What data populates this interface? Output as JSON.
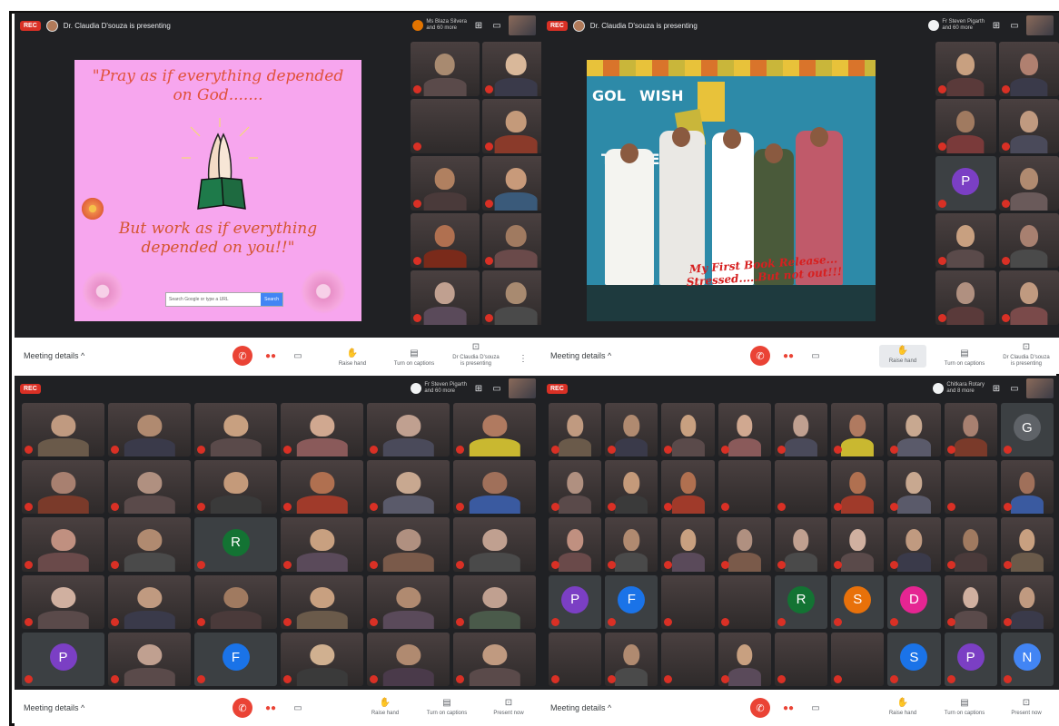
{
  "colors": {
    "meet_dark": "#202124",
    "tile_dark": "#3c4043",
    "end_call_red": "#ea4335",
    "mic_off_red": "#d93025",
    "slide1_pink": "#f7a6ee",
    "slide1_text": "#e0513a",
    "slide2_blue": "#2d8aa8",
    "caption_red": "#d62020"
  },
  "common": {
    "rec_label": "REC",
    "meeting_details_label": "Meeting details ^",
    "end_call_icon": "phone-hangup-icon",
    "raise_hand_label": "Raise hand",
    "captions_label": "Turn on captions",
    "present_now_label": "Present now"
  },
  "q1": {
    "presenting_text": "Dr. Claudia D'souza is presenting",
    "pinned_name": "Ms Blaza Silvera",
    "pinned_sub": "and 60 more",
    "presenter_action_label": "Dr Claudia D'souza is presenting",
    "slide": {
      "quote_top_line1": "\"Pray as if everything depended",
      "quote_top_line2": "on God.......",
      "quote_bottom_line1": "But work as if everything",
      "quote_bottom_line2": "depended on you!!\"",
      "search_placeholder": "Search Google or type a URL",
      "search_button": "Search"
    },
    "tiles": [
      {
        "tone": "#a88a70",
        "body": "#5a4a4a"
      },
      {
        "tone": "#d9b89a",
        "body": "#3a3a4a"
      },
      {
        "tone": "#3c4043",
        "body": "#3c4043",
        "blank": true
      },
      {
        "tone": "#c49a7a",
        "body": "#8a3a2a"
      },
      {
        "tone": "#b08060",
        "body": "#4a3a3a"
      },
      {
        "tone": "#c89a7a",
        "body": "#3a5a7a"
      },
      {
        "tone": "#b07050",
        "body": "#7a2a1a"
      },
      {
        "tone": "#a07a60",
        "body": "#6a4a4a"
      },
      {
        "tone": "#c0a090",
        "body": "#5a4a5a"
      },
      {
        "tone": "#a88a70",
        "body": "#4a4a4a"
      }
    ]
  },
  "q2": {
    "presenting_text": "Dr. Claudia D'souza is presenting",
    "pinned_name": "Fr Steven Pigarth",
    "pinned_sub": "and 60 more",
    "presenter_action_label": "Dr Claudia D'souza is presenting",
    "slide": {
      "banner_word1": "GOL",
      "banner_word2": "WISH",
      "banner_word3": "TO",
      "banner_word4": "OE",
      "caption_line1": "My First Book Release...",
      "caption_line2": "Stressed.....But not out!!!"
    },
    "tiles": [
      {
        "tone": "#c8a080",
        "body": "#5a3a3a"
      },
      {
        "tone": "#b08070",
        "body": "#3a3a4a"
      },
      {
        "tone": "#a07a60",
        "body": "#7a3a3a"
      },
      {
        "tone": "#c09a80",
        "body": "#4a4a5a"
      },
      {
        "initial": "P",
        "initial_color": "#7b3fc4"
      },
      {
        "tone": "#b08a70",
        "body": "#6a5a5a"
      },
      {
        "tone": "#c8a080",
        "body": "#5a4a4a"
      },
      {
        "tone": "#a88070",
        "body": "#4a4a4a"
      },
      {
        "tone": "#b09080",
        "body": "#5a3a3a"
      },
      {
        "tone": "#c09a80",
        "body": "#7a4a4a"
      }
    ]
  },
  "q3": {
    "pinned_name": "Fr Steven Pigarth",
    "pinned_sub": "and 60 more",
    "tiles": [
      {
        "tone": "#c09a80",
        "body": "#6a5a4a"
      },
      {
        "tone": "#b08a70",
        "body": "#3a3a4a"
      },
      {
        "tone": "#c8a080",
        "body": "#5a4a4a"
      },
      {
        "tone": "#d0a890",
        "body": "#8a5a5a"
      },
      {
        "tone": "#c0a090",
        "body": "#4a4a5a"
      },
      {
        "tone": "#b07a60",
        "body": "#c9b830"
      },
      {
        "tone": "#a88070",
        "body": "#7a3a2a"
      },
      {
        "tone": "#b09080",
        "body": "#5a4a4a"
      },
      {
        "tone": "#c49a7a",
        "body": "#3a3a3a"
      },
      {
        "tone": "#b07050",
        "body": "#a03a2a"
      },
      {
        "tone": "#c8a890",
        "body": "#5a5a6a"
      },
      {
        "tone": "#a0705a",
        "body": "#3a5aa0"
      },
      {
        "tone": "#c09080",
        "body": "#6a4a4a"
      },
      {
        "tone": "#b08a70",
        "body": "#4a4a4a"
      },
      {
        "initial": "R",
        "initial_color": "#137333"
      },
      {
        "tone": "#c8a080",
        "body": "#5a4a5a"
      },
      {
        "tone": "#b09080",
        "body": "#7a5a4a"
      },
      {
        "tone": "#c0a090",
        "body": "#4a4a4a"
      },
      {
        "tone": "#d0b0a0",
        "body": "#5a4a4a"
      },
      {
        "tone": "#c09a80",
        "body": "#3a3a4a"
      },
      {
        "tone": "#a07a60",
        "body": "#4a3a3a"
      },
      {
        "tone": "#c8a080",
        "body": "#6a5a4a"
      },
      {
        "tone": "#b08a70",
        "body": "#5a4a5a"
      },
      {
        "tone": "#c0a090",
        "body": "#4a5a4a"
      },
      {
        "initial": "P",
        "initial_color": "#7b3fc4"
      },
      {
        "tone": "#c0a090",
        "body": "#5a4a4a"
      },
      {
        "initial": "F",
        "initial_color": "#1a73e8"
      },
      {
        "tone": "#d0b090",
        "body": "#3a3a3a"
      },
      {
        "tone": "#b08a70",
        "body": "#4a3a4a"
      },
      {
        "tone": "#c09a80",
        "body": "#5a4a4a"
      }
    ]
  },
  "q4": {
    "pinned_name": "Chitkara Rotary",
    "pinned_sub": "and 8 more",
    "tiles": [
      {
        "tone": "#c09a80",
        "body": "#6a5a4a"
      },
      {
        "tone": "#b08a70",
        "body": "#3a3a4a"
      },
      {
        "tone": "#c8a080",
        "body": "#5a4a4a"
      },
      {
        "tone": "#d0a890",
        "body": "#8a5a5a"
      },
      {
        "tone": "#c0a090",
        "body": "#4a4a5a"
      },
      {
        "tone": "#b07a60",
        "body": "#c9b830"
      },
      {
        "tone": "#c8a890",
        "body": "#5a5a6a"
      },
      {
        "tone": "#a88070",
        "body": "#7a3a2a"
      },
      {
        "initial": "G",
        "initial_color": "#5f6368"
      },
      {
        "tone": "#b09080",
        "body": "#5a4a4a"
      },
      {
        "tone": "#c49a7a",
        "body": "#3a3a3a"
      },
      {
        "tone": "#b07050",
        "body": "#a03a2a"
      },
      {
        "tone": "#3c4043",
        "body": "#3c4043",
        "blank": true
      },
      {
        "tone": "#3c4043",
        "body": "#3c4043",
        "blank": true
      },
      {
        "tone": "#b07050",
        "body": "#a03a2a"
      },
      {
        "tone": "#c8a890",
        "body": "#5a5a6a"
      },
      {
        "tone": "#3c4043",
        "body": "#3c4043",
        "blank": true
      },
      {
        "tone": "#a0705a",
        "body": "#3a5aa0"
      },
      {
        "tone": "#c09080",
        "body": "#6a4a4a"
      },
      {
        "tone": "#b08a70",
        "body": "#4a4a4a"
      },
      {
        "tone": "#c8a080",
        "body": "#5a4a5a"
      },
      {
        "tone": "#b09080",
        "body": "#7a5a4a"
      },
      {
        "tone": "#c0a090",
        "body": "#4a4a4a"
      },
      {
        "tone": "#d0b0a0",
        "body": "#5a4a4a"
      },
      {
        "tone": "#c09a80",
        "body": "#3a3a4a"
      },
      {
        "tone": "#a07a60",
        "body": "#4a3a3a"
      },
      {
        "tone": "#c8a080",
        "body": "#6a5a4a"
      },
      {
        "initial": "P",
        "initial_color": "#7b3fc4"
      },
      {
        "initial": "F",
        "initial_color": "#1a73e8"
      },
      {
        "tone": "#3c4043",
        "body": "#3c4043",
        "blank": true
      },
      {
        "tone": "#3c4043",
        "body": "#3c4043",
        "blank": true
      },
      {
        "initial": "R",
        "initial_color": "#137333"
      },
      {
        "initial": "S",
        "initial_color": "#e8710a"
      },
      {
        "initial": "D",
        "initial_color": "#e52592"
      },
      {
        "tone": "#d0b0a0",
        "body": "#5a4a4a"
      },
      {
        "tone": "#c09a80",
        "body": "#3a3a4a"
      },
      {
        "tone": "#3c4043",
        "body": "#3c4043",
        "blank": true
      },
      {
        "tone": "#b08a70",
        "body": "#4a4a4a"
      },
      {
        "tone": "#3c4043",
        "body": "#3c4043",
        "blank": true
      },
      {
        "tone": "#c8a080",
        "body": "#5a4a5a"
      },
      {
        "tone": "#3c4043",
        "body": "#3c4043",
        "blank": true
      },
      {
        "tone": "#3c4043",
        "body": "#3c4043",
        "blank": true
      },
      {
        "initial": "S",
        "initial_color": "#1a73e8"
      },
      {
        "initial": "P",
        "initial_color": "#7b3fc4"
      },
      {
        "initial": "N",
        "initial_color": "#4285f4"
      }
    ]
  }
}
